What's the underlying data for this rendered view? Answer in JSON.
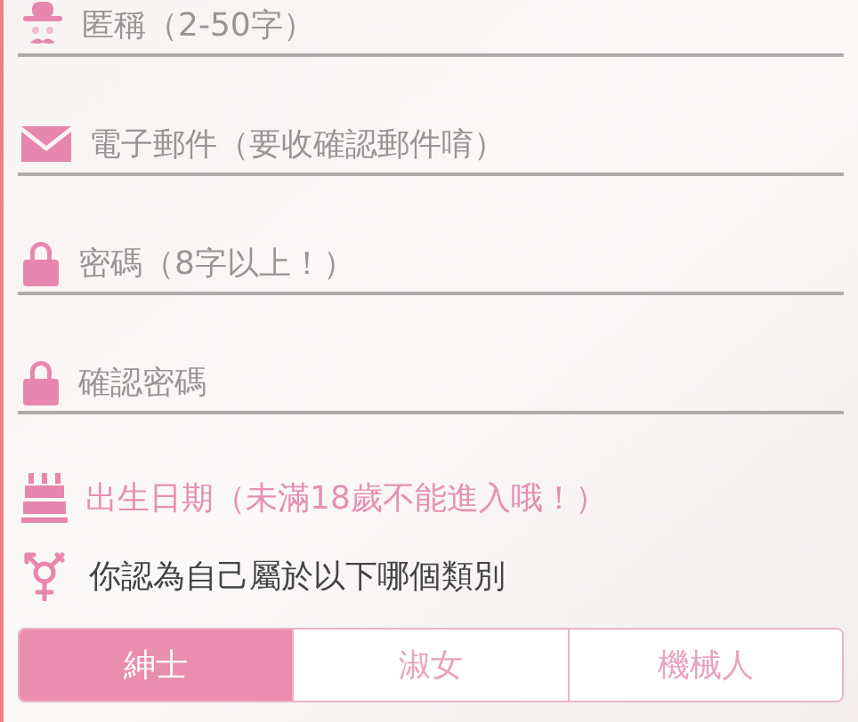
{
  "fields": [
    {
      "kind": "nickname",
      "placeholder": "匿稱（2-50字）"
    },
    {
      "kind": "email",
      "placeholder": "電子郵件（要收確認郵件唷）"
    },
    {
      "kind": "password",
      "placeholder": "密碼（8字以上！）"
    },
    {
      "kind": "password",
      "placeholder": "確認密碼"
    }
  ],
  "birthday": {
    "label": "出生日期（未滿18歲不能進入哦！）"
  },
  "gender": {
    "question": "你認為自己屬於以下哪個類別",
    "options": [
      {
        "label": "紳士",
        "selected": true
      },
      {
        "label": "淑女",
        "selected": false
      },
      {
        "label": "機械人",
        "selected": false
      }
    ]
  }
}
